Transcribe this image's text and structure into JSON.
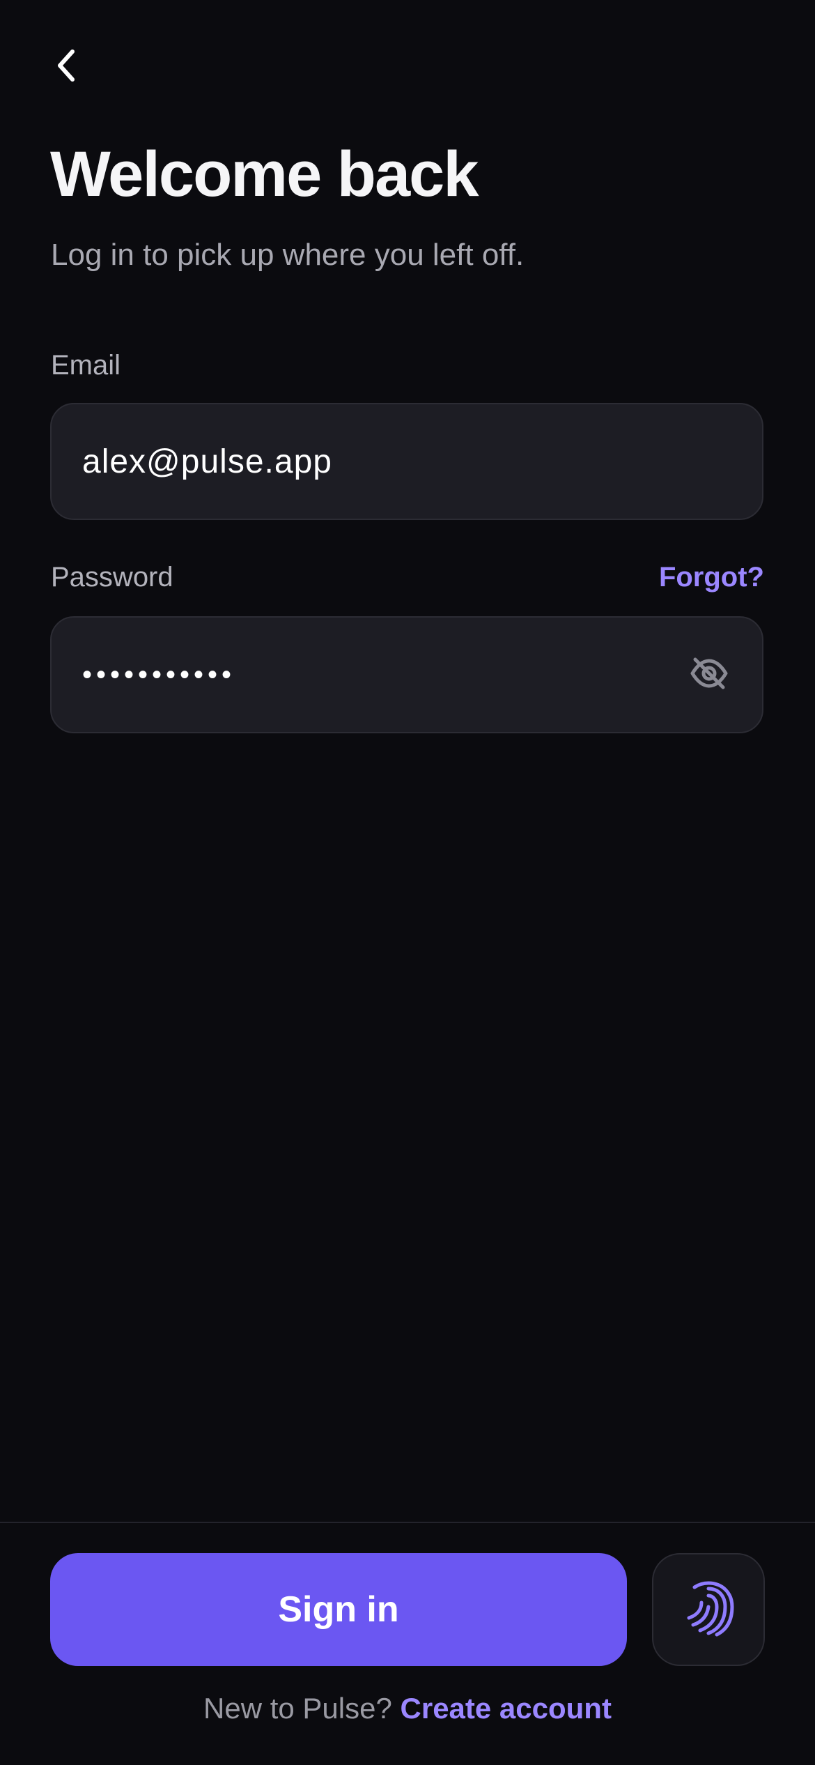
{
  "header": {
    "back_icon": "chevron-left-icon",
    "title": "Welcome back",
    "subtitle": "Log in to pick up where you left off."
  },
  "form": {
    "email": {
      "label": "Email",
      "value": "alex@pulse.app"
    },
    "password": {
      "label": "Password",
      "masked_value": "•••••••••••",
      "forgot_label": "Forgot?",
      "visibility_icon": "eye-off-icon"
    }
  },
  "actions": {
    "sign_in_label": "Sign in",
    "biometric_icon": "fingerprint-icon"
  },
  "footer": {
    "prompt": "New to Pulse?",
    "create_account_label": "Create account"
  },
  "colors": {
    "background": "#0b0b0f",
    "accent": "#6b57f2",
    "link": "#9b87ff",
    "input_bg": "#1d1d24"
  }
}
